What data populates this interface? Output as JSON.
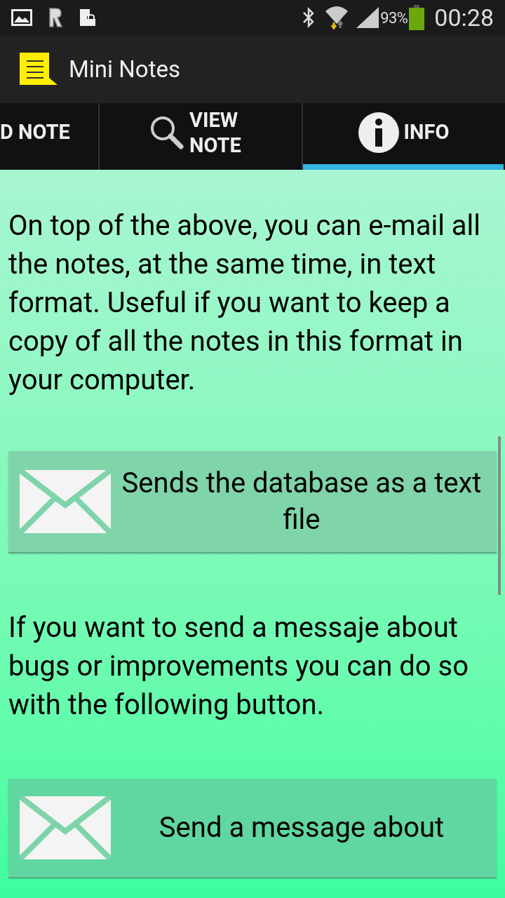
{
  "status_bar": {
    "battery_percent": "93%",
    "time": "00:28"
  },
  "app_bar": {
    "title": "Mini Notes"
  },
  "tabs": [
    {
      "kind": "add",
      "label": "D NOTE",
      "selected": false
    },
    {
      "kind": "view",
      "label": "VIEW NOTE",
      "selected": false
    },
    {
      "kind": "info",
      "label": "INFO",
      "selected": true
    }
  ],
  "content": [
    {
      "kind": "text",
      "text": "On top of the above, you can e-mail all the notes, at the same time, in text format. Useful if you want to keep a copy of all the notes in this format in your computer."
    },
    {
      "kind": "button",
      "label": "Sends the database as a text file"
    },
    {
      "kind": "text",
      "text": "If you want to send a messaje about bugs or improvements you can do so with the following button."
    },
    {
      "kind": "button",
      "label": "Send a message about"
    }
  ]
}
